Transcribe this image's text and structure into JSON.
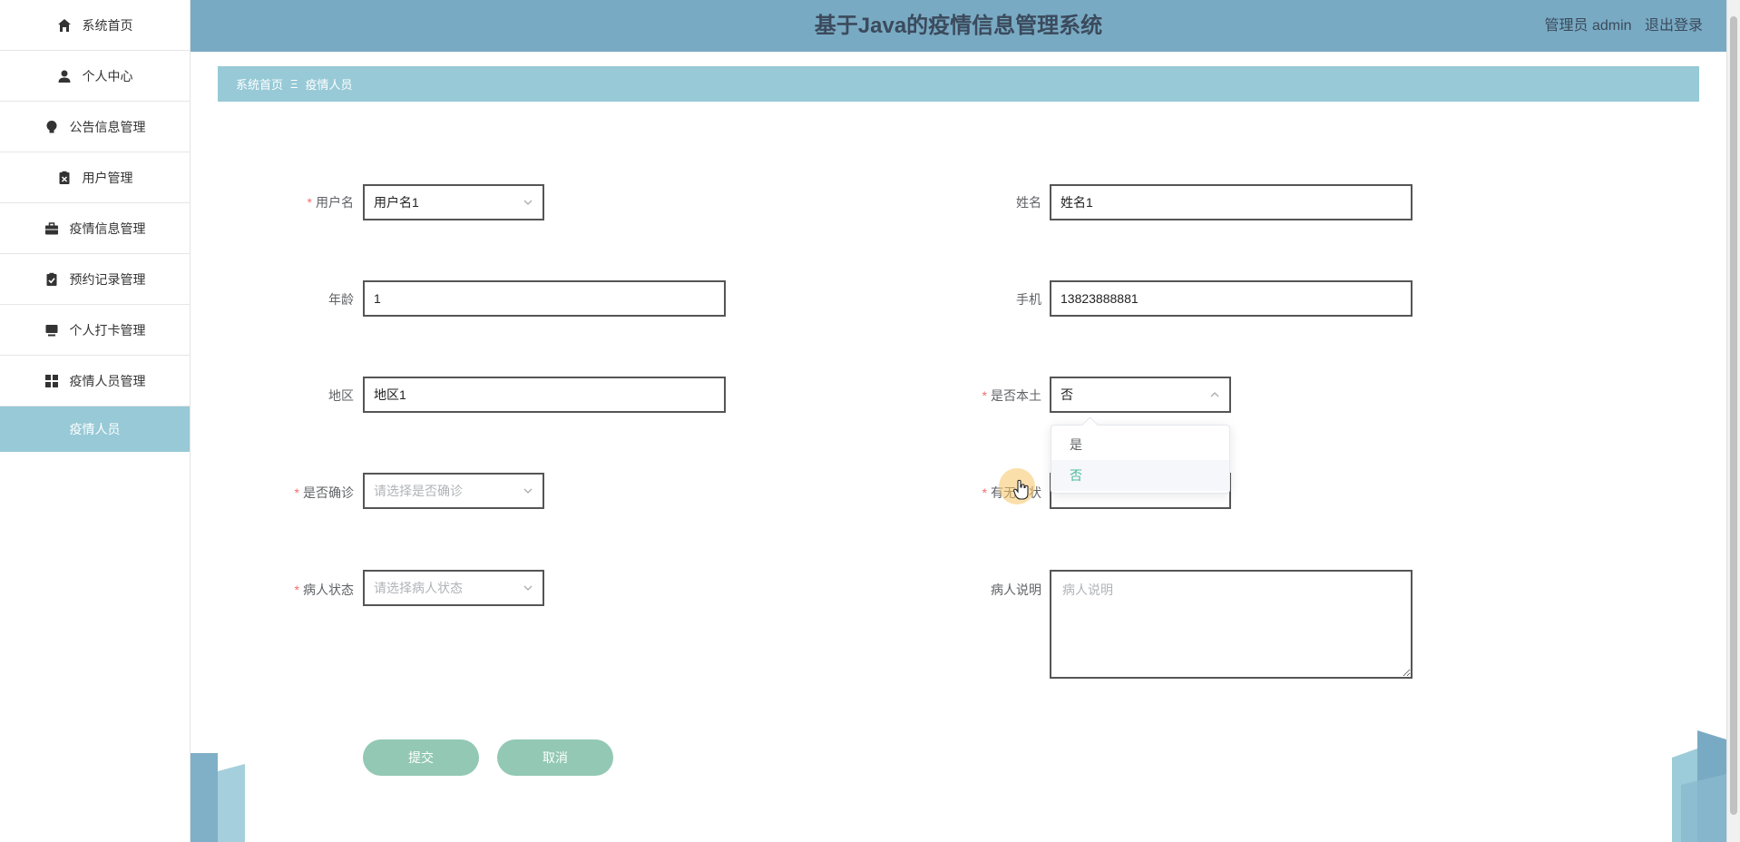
{
  "header": {
    "title": "基于Java的疫情信息管理系统",
    "user_label": "管理员 admin",
    "logout_label": "退出登录"
  },
  "sidebar": {
    "items": [
      {
        "label": "系统首页",
        "icon": "home-icon"
      },
      {
        "label": "个人中心",
        "icon": "person-icon"
      },
      {
        "label": "公告信息管理",
        "icon": "bulb-icon"
      },
      {
        "label": "用户管理",
        "icon": "clipboard-x-icon"
      },
      {
        "label": "疫情信息管理",
        "icon": "briefcase-icon"
      },
      {
        "label": "预约记录管理",
        "icon": "clipboard-check-icon"
      },
      {
        "label": "个人打卡管理",
        "icon": "monitor-icon"
      },
      {
        "label": "疫情人员管理",
        "icon": "grid-icon"
      }
    ],
    "sub_item": "疫情人员"
  },
  "breadcrumb": {
    "home": "系统首页",
    "sep": "Ξ",
    "current": "疫情人员"
  },
  "form": {
    "username": {
      "label": "用户名",
      "value": "用户名1"
    },
    "name": {
      "label": "姓名",
      "value": "姓名1"
    },
    "age": {
      "label": "年龄",
      "value": "1"
    },
    "phone": {
      "label": "手机",
      "value": "13823888881"
    },
    "region": {
      "label": "地区",
      "value": "地区1"
    },
    "is_local": {
      "label": "是否本土",
      "value": "否",
      "options": [
        "是",
        "否"
      ]
    },
    "is_confirmed": {
      "label": "是否确诊",
      "placeholder": "请选择是否确诊"
    },
    "symptom": {
      "label": "有无症状"
    },
    "status": {
      "label": "病人状态",
      "placeholder": "请选择病人状态"
    },
    "note": {
      "label": "病人说明",
      "placeholder": "病人说明"
    },
    "submit_label": "提交",
    "cancel_label": "取消"
  },
  "colors": {
    "header_bg": "#79aac3",
    "breadcrumb_bg": "#97c9d6",
    "button_bg": "#92c8b4",
    "required": "#f56c6c",
    "selected_option": "#4cb89a"
  }
}
